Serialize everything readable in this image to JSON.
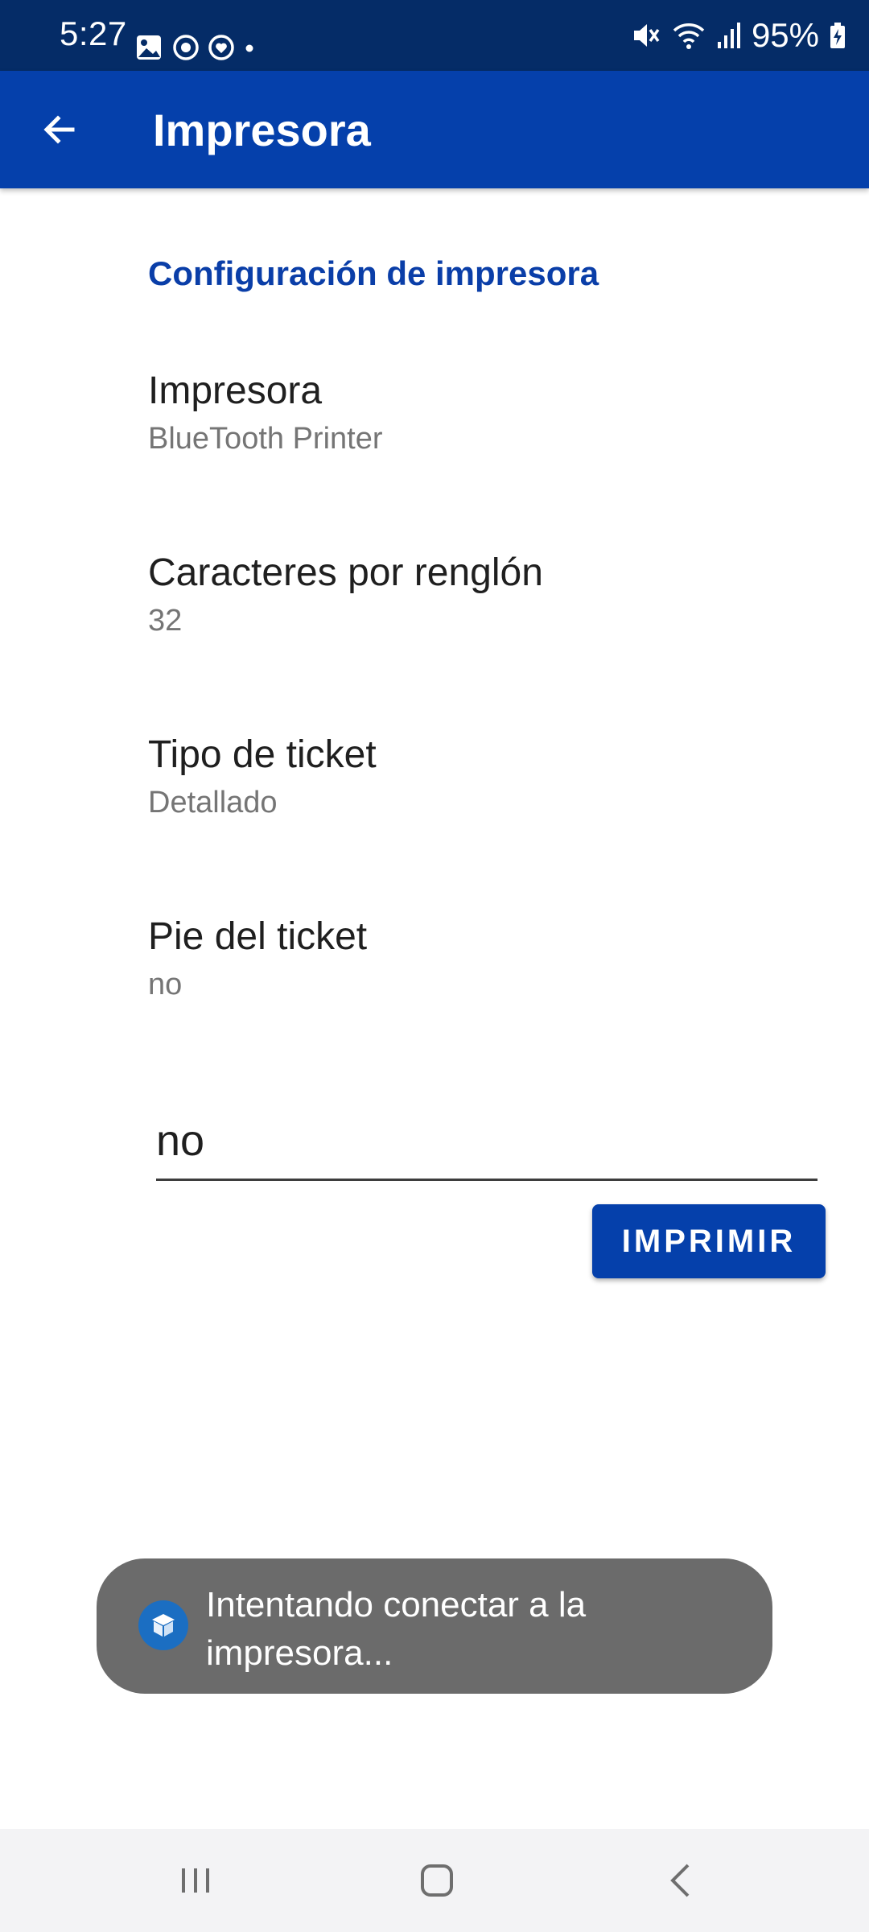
{
  "status_bar": {
    "time": "5:27",
    "battery": "95%"
  },
  "app_bar": {
    "title": "Impresora",
    "back_icon": "arrow-back-icon"
  },
  "section": {
    "title": "Configuración de impresora"
  },
  "preferences": [
    {
      "title": "Impresora",
      "summary": "BlueTooth Printer"
    },
    {
      "title": "Caracteres por renglón",
      "summary": "32"
    },
    {
      "title": "Tipo de ticket",
      "summary": "Detallado"
    },
    {
      "title": "Pie del ticket",
      "summary": "no"
    }
  ],
  "footer_input": {
    "value": "no"
  },
  "print_button": {
    "label": "IMPRIMIR"
  },
  "toast": {
    "message": "Intentando conectar a la impresora..."
  },
  "colors": {
    "status_bar": "#052c67",
    "app_bar": "#0540ab",
    "accent": "#0a3ea8",
    "toast_bg": "#6b6b6b"
  }
}
